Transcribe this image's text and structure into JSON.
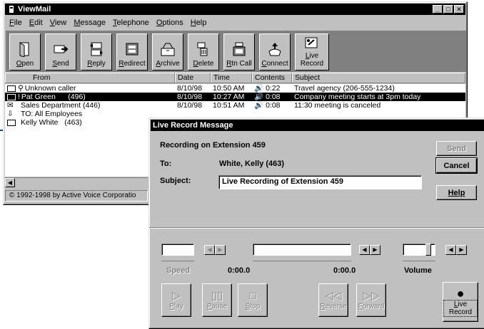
{
  "main_window": {
    "title": "ViewMail",
    "menu": [
      "File",
      "Edit",
      "View",
      "Message",
      "Telephone",
      "Options",
      "Help"
    ],
    "toolbar": [
      "Open",
      "Send",
      "Reply",
      "Redirect",
      "Archive",
      "Delete",
      "Rtn Call",
      "Connect",
      "Live Record"
    ],
    "columns": [
      "From",
      "Date",
      "Time",
      "Contents",
      "Subject"
    ],
    "messages": [
      {
        "from": "Unknown caller",
        "date": "8/10/98",
        "time": "10:50 AM",
        "length": "0:22",
        "subject": "Travel agency (206-555-1234)",
        "selected": false
      },
      {
        "from": "Pat Green      (496)",
        "date": "8/10/98",
        "time": "10:27 AM",
        "length": "0:08",
        "subject": "Company meeting starts at 3pm today",
        "selected": true
      },
      {
        "from": "Sales Department (446)",
        "date": "8/10/98",
        "time": "10:51 AM",
        "length": "0:08",
        "subject": "11:30 meeting is canceled",
        "selected": false
      },
      {
        "from": "TO: All Employees",
        "date": "",
        "time": "",
        "length": "",
        "subject": "",
        "selected": false
      },
      {
        "from": "Kelly White   (463)",
        "date": "",
        "time": "",
        "length": "",
        "subject": "",
        "selected": false
      }
    ],
    "status": "© 1992-1998 by Active Voice Corporatio"
  },
  "dialog": {
    "title": "Live Record Message",
    "recording_label": "Recording on Extension 459",
    "to_label": "To:",
    "to_value": "White, Kelly (463)",
    "subject_label": "Subject:",
    "subject_value": "Live Recording of Extension 459",
    "buttons": {
      "send": "Send",
      "cancel": "Cancel",
      "help": "Help"
    },
    "speed_label": "Speed",
    "position": "0:00.0",
    "length": "0:00.0",
    "volume_label": "Volume",
    "volume_level": 0.85,
    "controls": {
      "play": "Play",
      "pause": "Pause",
      "stop": "Stop",
      "reverse": "Reverse",
      "forward": "Forward",
      "live_record": "Live Record"
    }
  }
}
